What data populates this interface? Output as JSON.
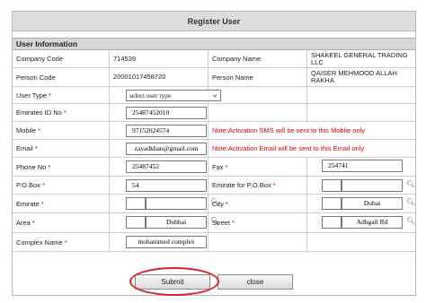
{
  "dialog": {
    "title": "Register User"
  },
  "section": {
    "title": "User Information"
  },
  "company": {
    "code_label": "Company Code",
    "code": "714539",
    "name_label": "Company Name",
    "name": "SHAKEEL GENERAL TRADING LLC"
  },
  "person": {
    "code_label": "Person Code",
    "code": "20001017458720",
    "name_label": "Person Name",
    "name": "QAISER MEHMOOD ALLAH RAKHA"
  },
  "user_type": {
    "label": "User Type",
    "required_mark": "*",
    "selected": "select user type"
  },
  "emirates_id": {
    "label": "Emirates ID No",
    "required_mark": "*",
    "value": "25487452010"
  },
  "mobile": {
    "label": "Mobile",
    "required_mark": "*",
    "value": "97152024574",
    "note": "Note:Activation SMS will be sent to this Mobile only"
  },
  "email": {
    "label": "Email",
    "required_mark": "*",
    "value": "zayadkhan@gmail.com",
    "note": "Note:Activation Email will be sent to this Email only"
  },
  "phone": {
    "label": "Phone No",
    "required_mark": "*",
    "value": "25487452"
  },
  "fax": {
    "label": "Fax",
    "required_mark": "*",
    "value": "254741"
  },
  "po_box": {
    "label": "P.O.Box",
    "required_mark": "*",
    "value": "54"
  },
  "emirate_po": {
    "label": "Emirate for P.O.Box",
    "required_mark": "*",
    "value": ""
  },
  "emirate": {
    "label": "Emirate",
    "required_mark": "*",
    "value": ""
  },
  "city": {
    "label": "City",
    "required_mark": "*",
    "value": "Dubai"
  },
  "area": {
    "label": "Area",
    "required_mark": "*",
    "value": "Dubhai"
  },
  "street": {
    "label": "Street",
    "required_mark": "*",
    "value": "Adhgail Rd"
  },
  "complex": {
    "label": "Complex Name",
    "required_mark": "*",
    "value": "mohammed complex"
  },
  "buttons": {
    "submit": "Submit",
    "close": "close"
  },
  "colors": {
    "required": "#d40000",
    "note": "#e00000",
    "highlight_ring": "#d9232a"
  },
  "icons": {
    "dropdown": "chevron-down-icon",
    "lookup": "magnifier-icon"
  }
}
